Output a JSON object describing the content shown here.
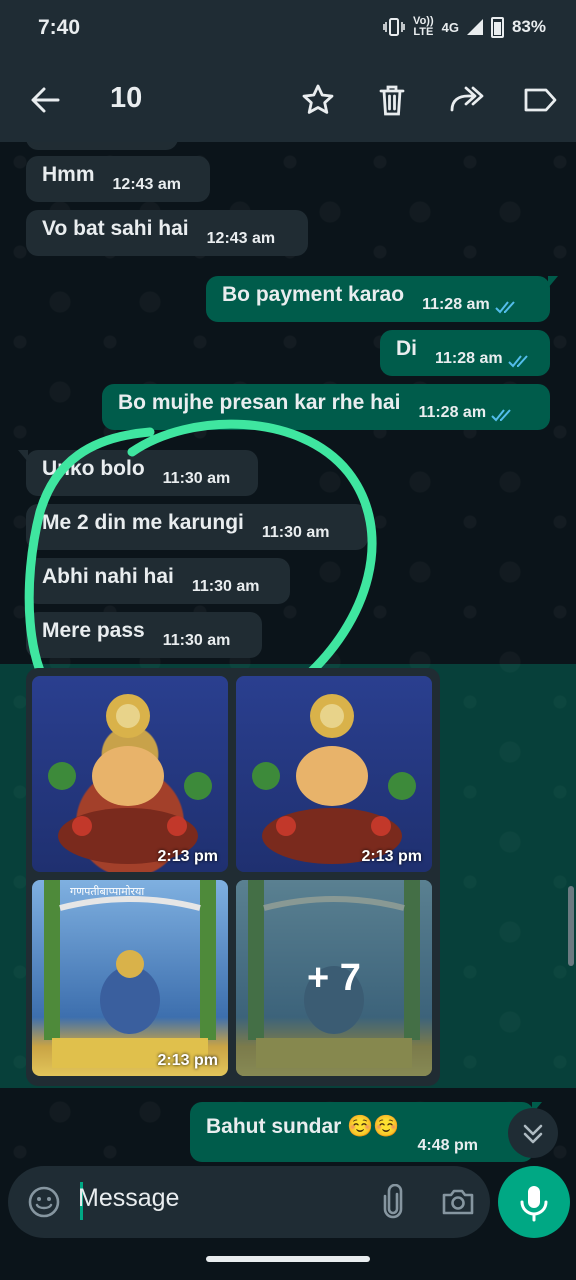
{
  "status": {
    "time": "7:40",
    "network_top": "Vo))",
    "network_bottom": "LTE",
    "net_type": "4G",
    "battery": "83%"
  },
  "header": {
    "selected_count": "10"
  },
  "messages": [
    {
      "dir": "in",
      "text": "Hmm",
      "time": "12:43 am"
    },
    {
      "dir": "in",
      "text": "Vo bat sahi hai",
      "time": "12:43 am"
    },
    {
      "dir": "out",
      "text": "Bo payment karao",
      "time": "11:28 am"
    },
    {
      "dir": "out",
      "text": "Di",
      "time": "11:28 am"
    },
    {
      "dir": "out",
      "text": "Bo mujhe presan kar rhe hai",
      "time": "11:28 am"
    },
    {
      "dir": "in",
      "text": "Unko bolo",
      "time": "11:30 am"
    },
    {
      "dir": "in",
      "text": "Me 2 din me karungi",
      "time": "11:30 am"
    },
    {
      "dir": "in",
      "text": "Abhi nahi hai",
      "time": "11:30 am"
    },
    {
      "dir": "in",
      "text": "Mere pass",
      "time": "11:30 am"
    },
    {
      "dir": "out",
      "text": "Bahut sundar ☺️☺️",
      "time": "4:48 pm"
    }
  ],
  "gallery": {
    "photos": [
      {
        "time": "2:13 pm"
      },
      {
        "time": "2:13 pm"
      },
      {
        "time": "2:13 pm"
      }
    ],
    "more_count": "+ 7",
    "banner_text": "गणपतीबाप्पामोरया"
  },
  "composer": {
    "placeholder": "Message"
  },
  "colors": {
    "accent": "#00a884",
    "incoming": "#202c33",
    "outgoing": "#005c4b",
    "highlight_circle": "#3fe6a0",
    "read_ticks": "#53bdeb"
  }
}
